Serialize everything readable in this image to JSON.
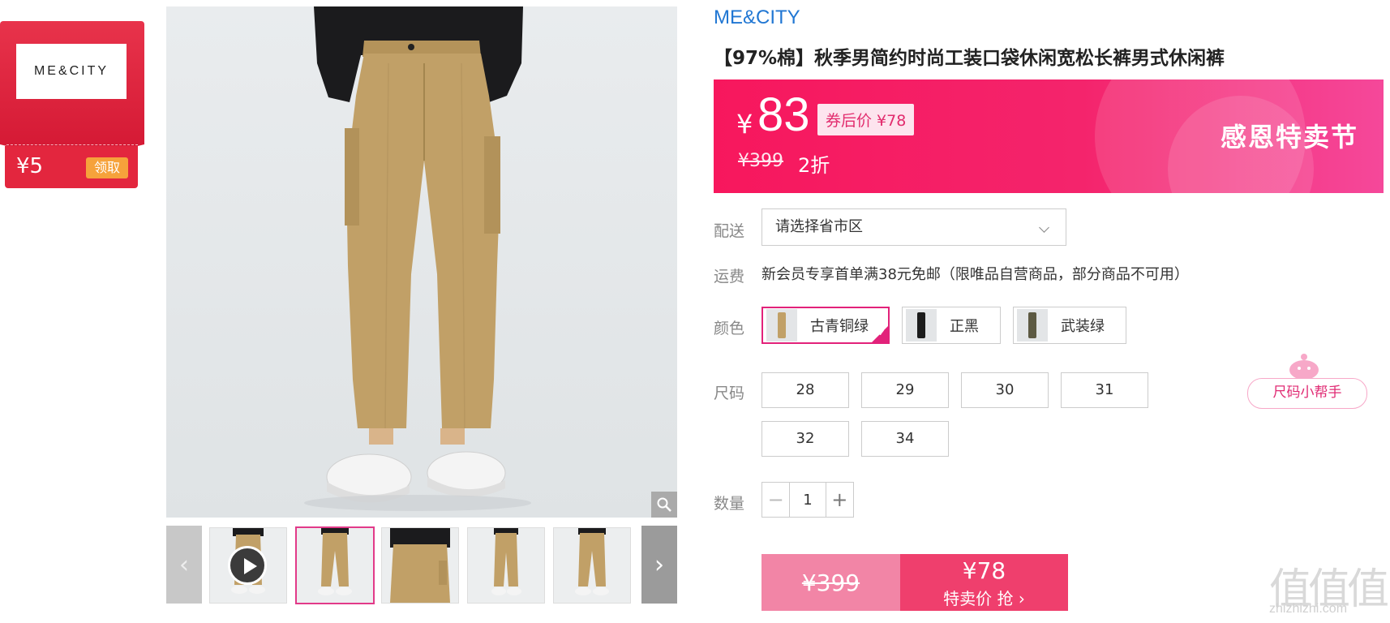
{
  "coupon": {
    "brand_logo": "ME&CITY",
    "amount": "¥5",
    "claim_label": "领取"
  },
  "product": {
    "brand": "ME&CITY",
    "title": "【97%棉】秋季男简约时尚工装口袋休闲宽松长裤男式休闲裤"
  },
  "price": {
    "currency": "¥",
    "current": "83",
    "after_coupon": "券后价 ¥78",
    "original": "¥399",
    "discount": "2折",
    "festival": "感恩特卖节"
  },
  "delivery": {
    "label": "配送",
    "placeholder": "请选择省市区"
  },
  "shipping": {
    "label": "运费",
    "text": "新会员专享首单满38元免邮（限唯品自营商品，部分商品不可用）"
  },
  "color": {
    "label": "颜色",
    "options": [
      {
        "name": "古青铜绿",
        "swatch": "#b8975c",
        "selected": true
      },
      {
        "name": "正黑",
        "swatch": "#1c1c1c",
        "selected": false
      },
      {
        "name": "武装绿",
        "swatch": "#5d5a43",
        "selected": false
      }
    ]
  },
  "size": {
    "label": "尺码",
    "options": [
      "28",
      "29",
      "30",
      "31",
      "32",
      "34"
    ],
    "helper": "尺码小帮手"
  },
  "quantity": {
    "label": "数量",
    "value": "1",
    "minus": "−",
    "plus": "+"
  },
  "buy": {
    "original": "¥399",
    "price": "¥78",
    "action": "特卖价 抢 ›"
  },
  "watermark": {
    "mark": "值值值",
    "site": "zhizhizhi.com"
  },
  "colors": {
    "accent": "#f4246c",
    "brand_blue": "#2177d3",
    "pants": "#c1a067"
  }
}
